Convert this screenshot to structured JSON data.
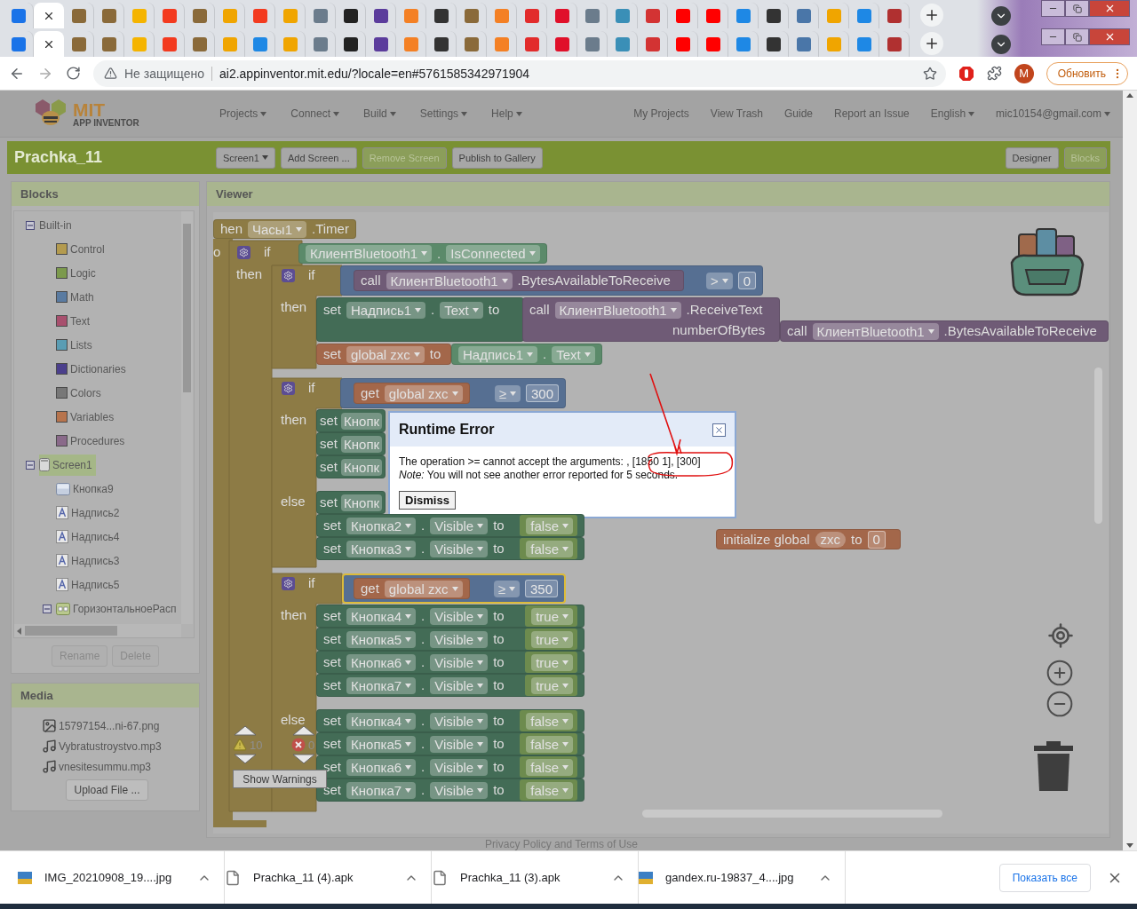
{
  "tab_rows": [
    {
      "tabs": [
        {
          "selected": false,
          "color": "#1a73e8"
        },
        {
          "selected": true
        },
        {
          "selected": false,
          "color": "#8a6a3a"
        },
        {
          "selected": false,
          "color": "#8a6a3a"
        },
        {
          "selected": false,
          "color": "#f5b400"
        },
        {
          "selected": false,
          "color": "#f33a1f"
        },
        {
          "selected": false,
          "color": "#8a6a3a"
        },
        {
          "selected": false,
          "color": "#f0a500"
        },
        {
          "selected": false,
          "color": "#f33a1f"
        },
        {
          "selected": false,
          "color": "#f0a500"
        },
        {
          "selected": false,
          "color": "#6b7c8c"
        },
        {
          "selected": false,
          "color": "#222222"
        },
        {
          "selected": false,
          "color": "#5b3c9c"
        },
        {
          "selected": false,
          "color": "#f48024"
        },
        {
          "selected": false,
          "color": "#333333"
        },
        {
          "selected": false,
          "color": "#8a6a3a"
        },
        {
          "selected": false,
          "color": "#f48024"
        },
        {
          "selected": false,
          "color": "#e22b2b"
        },
        {
          "selected": false,
          "color": "#e0102a"
        },
        {
          "selected": false,
          "color": "#6b7c8c"
        },
        {
          "selected": false,
          "color": "#3a8fb7"
        },
        {
          "selected": false,
          "color": "#d33333"
        },
        {
          "selected": false,
          "color": "#ff0000"
        },
        {
          "selected": false,
          "color": "#ff0000"
        },
        {
          "selected": false,
          "color": "#1e88e5"
        },
        {
          "selected": false,
          "color": "#333333"
        },
        {
          "selected": false,
          "color": "#4a76a8"
        },
        {
          "selected": false,
          "color": "#f0a500"
        },
        {
          "selected": false,
          "color": "#1e88e5"
        },
        {
          "selected": false,
          "color": "#b03030"
        }
      ]
    },
    {
      "tabs": [
        {
          "selected": false,
          "color": "#1a73e8"
        },
        {
          "selected": true
        },
        {
          "selected": false,
          "color": "#8a6a3a"
        },
        {
          "selected": false,
          "color": "#8a6a3a"
        },
        {
          "selected": false,
          "color": "#f5b400"
        },
        {
          "selected": false,
          "color": "#f33a1f"
        },
        {
          "selected": false,
          "color": "#8a6a3a"
        },
        {
          "selected": false,
          "color": "#f0a500"
        },
        {
          "selected": false,
          "color": "#1e88e5"
        },
        {
          "selected": false,
          "color": "#f0a500"
        },
        {
          "selected": false,
          "color": "#6b7c8c"
        },
        {
          "selected": false,
          "color": "#222222"
        },
        {
          "selected": false,
          "color": "#5b3c9c"
        },
        {
          "selected": false,
          "color": "#f48024"
        },
        {
          "selected": false,
          "color": "#333333"
        },
        {
          "selected": false,
          "color": "#8a6a3a"
        },
        {
          "selected": false,
          "color": "#f48024"
        },
        {
          "selected": false,
          "color": "#e22b2b"
        },
        {
          "selected": false,
          "color": "#e0102a"
        },
        {
          "selected": false,
          "color": "#6b7c8c"
        },
        {
          "selected": false,
          "color": "#3a8fb7"
        },
        {
          "selected": false,
          "color": "#d33333"
        },
        {
          "selected": false,
          "color": "#ff0000"
        },
        {
          "selected": false,
          "color": "#ff0000"
        },
        {
          "selected": false,
          "color": "#1e88e5"
        },
        {
          "selected": false,
          "color": "#333333"
        },
        {
          "selected": false,
          "color": "#4a76a8"
        },
        {
          "selected": false,
          "color": "#f0a500"
        },
        {
          "selected": false,
          "color": "#1e88e5"
        },
        {
          "selected": false,
          "color": "#b03030"
        }
      ]
    }
  ],
  "address_bar": {
    "security": "Не защищено",
    "url": "ai2.appinventor.mit.edu/?locale=en#5761585342971904",
    "avatar": "M",
    "update_button": "Обновить"
  },
  "header": {
    "logo": {
      "title": "MIT",
      "subtitle": "APP INVENTOR"
    },
    "menus": [
      {
        "label": "Projects",
        "kind": "menu"
      },
      {
        "label": "Connect",
        "kind": "menu"
      },
      {
        "label": "Build",
        "kind": "menu"
      },
      {
        "label": "Settings",
        "kind": "menu"
      },
      {
        "label": "Help",
        "kind": "menu"
      }
    ],
    "links": [
      {
        "label": "My Projects",
        "kind": "link"
      },
      {
        "label": "View Trash",
        "kind": "link"
      },
      {
        "label": "Guide",
        "kind": "link"
      },
      {
        "label": "Report an Issue",
        "kind": "link"
      },
      {
        "label": "English",
        "kind": "menu"
      },
      {
        "label": "mic10154@gmail.com",
        "kind": "menu"
      }
    ]
  },
  "toolbar": {
    "project": "Prachka_11",
    "buttons": [
      {
        "label": "Screen1",
        "kind": "menu",
        "disabled": false
      },
      {
        "label": "Add Screen ...",
        "kind": "button",
        "disabled": false
      },
      {
        "label": "Remove Screen",
        "kind": "button",
        "disabled": true
      },
      {
        "label": "Publish to Gallery",
        "kind": "button",
        "disabled": false
      }
    ],
    "view_buttons": [
      {
        "label": "Designer",
        "selected": false
      },
      {
        "label": "Blocks",
        "selected": true
      }
    ]
  },
  "blocks_panel": {
    "title": "Blocks",
    "tree": [
      {
        "label": "Built-in",
        "expanded": true,
        "selected": false,
        "children": [
          {
            "label": "Control",
            "color": "#b49b4f",
            "selected": false
          },
          {
            "label": "Logic",
            "color": "#7c9a4d",
            "selected": false
          },
          {
            "label": "Math",
            "color": "#5a7ba1",
            "selected": false
          },
          {
            "label": "Text",
            "color": "#a8506e",
            "selected": false
          },
          {
            "label": "Lists",
            "color": "#5a9db4",
            "selected": false
          },
          {
            "label": "Dictionaries",
            "color": "#4b3f8c",
            "selected": false
          },
          {
            "label": "Colors",
            "color": "#777777",
            "selected": false
          },
          {
            "label": "Variables",
            "color": "#b7744d",
            "selected": false
          },
          {
            "label": "Procedures",
            "color": "#8a6a8a",
            "selected": false
          }
        ]
      },
      {
        "label": "Screen1",
        "kind": "screen",
        "expanded": true,
        "selected": true,
        "children": [
          {
            "label": "Кнопка9",
            "kind": "button",
            "selected": false
          },
          {
            "label": "Надпись2",
            "kind": "label",
            "selected": false
          },
          {
            "label": "Надпись4",
            "kind": "label",
            "selected": false
          },
          {
            "label": "Надпись3",
            "kind": "label",
            "selected": false
          },
          {
            "label": "Надпись5",
            "kind": "label",
            "selected": false
          },
          {
            "label": "ГоризонтальноеРасп",
            "kind": "arrangement",
            "expanded": true,
            "selected": false
          }
        ]
      }
    ],
    "buttons": [
      {
        "label": "Rename",
        "disabled": true
      },
      {
        "label": "Delete",
        "disabled": true
      }
    ]
  },
  "media_panel": {
    "title": "Media",
    "files": [
      {
        "name": "15797154...ni-67.png",
        "kind": "image"
      },
      {
        "name": "Vybratustroystvo.mp3",
        "kind": "audio"
      },
      {
        "name": "vnesitesummu.mp3",
        "kind": "audio"
      }
    ],
    "button": "Upload File ..."
  },
  "viewer": {
    "title": "Viewer"
  },
  "workspace": {
    "labels": [
      "o",
      "if",
      "then",
      "if",
      "then",
      "numberOfBytes",
      "if",
      "then",
      "else",
      "if",
      "then",
      "else"
    ],
    "blocks": [
      {
        "kind": "event",
        "selected": false,
        "parts": [
          {
            "kind": "word",
            "text": "hen"
          },
          {
            "kind": "dropdown",
            "text": "Часы1"
          },
          {
            "kind": "word",
            "text": ".Timer"
          }
        ]
      },
      {
        "kind": "getter",
        "selected": false,
        "parts": [
          {
            "kind": "dropdown",
            "text": "КлиентBluetooth1"
          },
          {
            "kind": "word",
            "text": "."
          },
          {
            "kind": "dropdown",
            "text": "IsConnected"
          }
        ]
      },
      {
        "kind": "method",
        "selected": false,
        "parts": [
          {
            "kind": "word",
            "text": "call"
          },
          {
            "kind": "dropdown",
            "text": "КлиентBluetooth1"
          },
          {
            "kind": "word",
            "text": ".BytesAvailableToReceive"
          }
        ]
      },
      {
        "kind": "math",
        "selected": false,
        "parts": [
          {
            "kind": "dropdown",
            "text": ">"
          },
          {
            "kind": "number",
            "text": "0"
          }
        ]
      },
      {
        "kind": "setter",
        "selected": false,
        "parts": [
          {
            "kind": "word",
            "text": "set"
          },
          {
            "kind": "dropdown",
            "text": "Надпись1"
          },
          {
            "kind": "word",
            "text": "."
          },
          {
            "kind": "dropdown",
            "text": "Text"
          },
          {
            "kind": "word",
            "text": "to"
          }
        ]
      },
      {
        "kind": "method",
        "selected": false,
        "parts": [
          {
            "kind": "word",
            "text": "call"
          },
          {
            "kind": "dropdown",
            "text": "КлиентBluetooth1"
          },
          {
            "kind": "word",
            "text": ".ReceiveText"
          }
        ]
      },
      {
        "kind": "method",
        "selected": false,
        "parts": [
          {
            "kind": "word",
            "text": "call"
          },
          {
            "kind": "dropdown",
            "text": "КлиентBluetooth1"
          },
          {
            "kind": "word",
            "text": ".BytesAvailableToReceive"
          }
        ]
      },
      {
        "kind": "variable",
        "selected": false,
        "parts": [
          {
            "kind": "word",
            "text": "set"
          },
          {
            "kind": "dropdown",
            "text": "global zxc"
          },
          {
            "kind": "word",
            "text": "to"
          }
        ]
      },
      {
        "kind": "getter",
        "selected": false,
        "parts": [
          {
            "kind": "dropdown",
            "text": "Надпись1"
          },
          {
            "kind": "word",
            "text": "."
          },
          {
            "kind": "dropdown",
            "text": "Text"
          }
        ]
      },
      {
        "kind": "variable",
        "selected": false,
        "parts": [
          {
            "kind": "word",
            "text": "get"
          },
          {
            "kind": "dropdown",
            "text": "global zxc"
          }
        ]
      },
      {
        "kind": "math",
        "selected": false,
        "parts": [
          {
            "kind": "dropdown",
            "text": "≥"
          },
          {
            "kind": "number",
            "text": "300"
          }
        ]
      },
      {
        "kind": "setter",
        "selected": false,
        "parts": [
          {
            "kind": "word",
            "text": "set"
          },
          {
            "kind": "chip",
            "text": "Кнопк"
          }
        ]
      },
      {
        "kind": "setter",
        "selected": false,
        "parts": [
          {
            "kind": "word",
            "text": "set"
          },
          {
            "kind": "chip",
            "text": "Кнопк"
          }
        ]
      },
      {
        "kind": "setter",
        "selected": false,
        "parts": [
          {
            "kind": "word",
            "text": "set"
          },
          {
            "kind": "chip",
            "text": "Кнопк"
          }
        ]
      },
      {
        "kind": "setter",
        "selected": false,
        "parts": [
          {
            "kind": "word",
            "text": "set"
          },
          {
            "kind": "chip",
            "text": "Кнопк"
          }
        ]
      },
      {
        "kind": "setter",
        "selected": false,
        "parts": [
          {
            "kind": "word",
            "text": "set"
          },
          {
            "kind": "dropdown",
            "text": "Кнопка2"
          },
          {
            "kind": "word",
            "text": "."
          },
          {
            "kind": "dropdown",
            "text": "Visible"
          },
          {
            "kind": "word",
            "text": "to"
          },
          {
            "kind": "literal",
            "text": "false"
          }
        ]
      },
      {
        "kind": "setter",
        "selected": false,
        "parts": [
          {
            "kind": "word",
            "text": "set"
          },
          {
            "kind": "dropdown",
            "text": "Кнопка3"
          },
          {
            "kind": "word",
            "text": "."
          },
          {
            "kind": "dropdown",
            "text": "Visible"
          },
          {
            "kind": "word",
            "text": "to"
          },
          {
            "kind": "literal",
            "text": "false"
          }
        ]
      },
      {
        "kind": "variable",
        "selected": false,
        "parts": [
          {
            "kind": "word",
            "text": "get"
          },
          {
            "kind": "dropdown",
            "text": "global zxc"
          }
        ]
      },
      {
        "kind": "math",
        "selected": true,
        "parts": [
          {
            "kind": "dropdown",
            "text": "≥"
          },
          {
            "kind": "number",
            "text": "350"
          }
        ]
      },
      {
        "kind": "setter",
        "selected": false,
        "parts": [
          {
            "kind": "word",
            "text": "set"
          },
          {
            "kind": "dropdown",
            "text": "Кнопка4"
          },
          {
            "kind": "word",
            "text": "."
          },
          {
            "kind": "dropdown",
            "text": "Visible"
          },
          {
            "kind": "word",
            "text": "to"
          },
          {
            "kind": "literal",
            "text": "true"
          }
        ]
      },
      {
        "kind": "setter",
        "selected": false,
        "parts": [
          {
            "kind": "word",
            "text": "set"
          },
          {
            "kind": "dropdown",
            "text": "Кнопка5"
          },
          {
            "kind": "word",
            "text": "."
          },
          {
            "kind": "dropdown",
            "text": "Visible"
          },
          {
            "kind": "word",
            "text": "to"
          },
          {
            "kind": "literal",
            "text": "true"
          }
        ]
      },
      {
        "kind": "setter",
        "selected": false,
        "parts": [
          {
            "kind": "word",
            "text": "set"
          },
          {
            "kind": "dropdown",
            "text": "Кнопка6"
          },
          {
            "kind": "word",
            "text": "."
          },
          {
            "kind": "dropdown",
            "text": "Visible"
          },
          {
            "kind": "word",
            "text": "to"
          },
          {
            "kind": "literal",
            "text": "true"
          }
        ]
      },
      {
        "kind": "setter",
        "selected": false,
        "parts": [
          {
            "kind": "word",
            "text": "set"
          },
          {
            "kind": "dropdown",
            "text": "Кнопка7"
          },
          {
            "kind": "word",
            "text": "."
          },
          {
            "kind": "dropdown",
            "text": "Visible"
          },
          {
            "kind": "word",
            "text": "to"
          },
          {
            "kind": "literal",
            "text": "true"
          }
        ]
      },
      {
        "kind": "setter",
        "selected": false,
        "parts": [
          {
            "kind": "word",
            "text": "set"
          },
          {
            "kind": "dropdown",
            "text": "Кнопка4"
          },
          {
            "kind": "word",
            "text": "."
          },
          {
            "kind": "dropdown",
            "text": "Visible"
          },
          {
            "kind": "word",
            "text": "to"
          },
          {
            "kind": "literal",
            "text": "false"
          }
        ]
      },
      {
        "kind": "setter",
        "selected": false,
        "parts": [
          {
            "kind": "word",
            "text": "set"
          },
          {
            "kind": "dropdown",
            "text": "Кнопка5"
          },
          {
            "kind": "word",
            "text": "."
          },
          {
            "kind": "dropdown",
            "text": "Visible"
          },
          {
            "kind": "word",
            "text": "to"
          },
          {
            "kind": "literal",
            "text": "false"
          }
        ]
      },
      {
        "kind": "setter",
        "selected": false,
        "parts": [
          {
            "kind": "word",
            "text": "set"
          },
          {
            "kind": "dropdown",
            "text": "Кнопка6"
          },
          {
            "kind": "word",
            "text": "."
          },
          {
            "kind": "dropdown",
            "text": "Visible"
          },
          {
            "kind": "word",
            "text": "to"
          },
          {
            "kind": "literal",
            "text": "false"
          }
        ]
      },
      {
        "kind": "setter",
        "selected": false,
        "parts": [
          {
            "kind": "word",
            "text": "set"
          },
          {
            "kind": "dropdown",
            "text": "Кнопка7"
          },
          {
            "kind": "word",
            "text": "."
          },
          {
            "kind": "dropdown",
            "text": "Visible"
          },
          {
            "kind": "word",
            "text": "to"
          },
          {
            "kind": "literal",
            "text": "false"
          }
        ]
      },
      {
        "kind": "variable",
        "selected": false,
        "parts": [
          {
            "kind": "word",
            "text": "initialize global"
          },
          {
            "kind": "name",
            "text": "zxc"
          },
          {
            "kind": "word",
            "text": "to"
          },
          {
            "kind": "number",
            "text": "0"
          }
        ]
      }
    ],
    "warnings": {
      "warnings_count": "10",
      "errors_count": "0",
      "button": "Show Warnings"
    }
  },
  "dialog": {
    "title": "Runtime Error",
    "message": "The operation >= cannot accept the arguments: , [1850 1], [300]",
    "note": "*Note:* You will not see another error reported for 5 seconds.",
    "button": "Dismiss"
  },
  "footer": "Privacy Policy and Terms of Use",
  "downloads": {
    "items": [
      {
        "name": "IMG_20210908_19....jpg",
        "kind": "image"
      },
      {
        "name": "Prachka_11 (4).apk",
        "kind": "file"
      },
      {
        "name": "Prachka_11 (3).apk",
        "kind": "file"
      },
      {
        "name": "gandex.ru-19837_4....jpg",
        "kind": "image"
      }
    ],
    "show_all": "Показать все"
  }
}
